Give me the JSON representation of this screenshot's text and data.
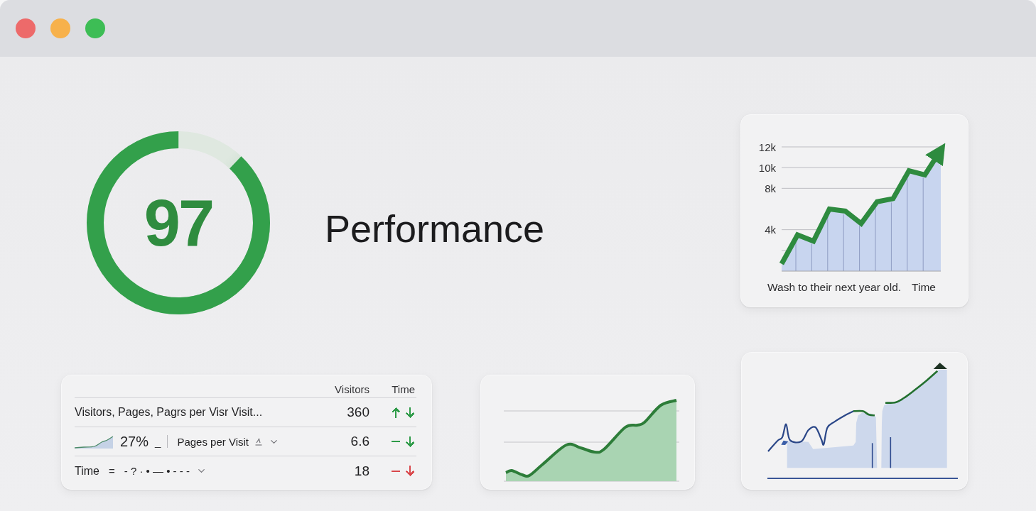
{
  "window": {
    "controls": [
      {
        "color": "#ed6a6a"
      },
      {
        "color": "#f7b14b"
      },
      {
        "color": "#3dbd55"
      }
    ]
  },
  "score": {
    "value": "97",
    "level": 0.88,
    "title": "Performance"
  },
  "trend_card": {
    "chart_data": {
      "type": "area",
      "xlabel": "Time",
      "categories": [
        null,
        null,
        null,
        null,
        null,
        null,
        null,
        null,
        null,
        null,
        null
      ],
      "series": [
        {
          "color": "#2e8b3f",
          "values": [
            700,
            3500,
            2900,
            6000,
            5800,
            4600,
            6700,
            7000,
            9700,
            9300,
            11700
          ]
        }
      ],
      "ylim": [
        0,
        12000
      ],
      "yticks": [
        {
          "value": 4000,
          "label": "4k"
        },
        {
          "value": 8000,
          "label": "8k"
        },
        {
          "value": 10000,
          "label": "10k"
        },
        {
          "value": 12000,
          "label": "12k"
        }
      ],
      "grid": true
    },
    "caption": "Wash to their next year old."
  },
  "table": {
    "columns": [
      "Visitors",
      "Time"
    ],
    "rows": [
      {
        "kind": "text",
        "label": "Visitors, Pages, Pagrs per Visr Visit...",
        "value": "360",
        "indicators": [
          {
            "kind": "up",
            "color": "#2e9b48"
          },
          {
            "kind": "down",
            "color": "#2e9b48"
          }
        ]
      },
      {
        "kind": "metric",
        "percent": "27%",
        "mark": "_",
        "select": "Pages per Visit",
        "value": "6.6",
        "indicators": [
          {
            "kind": "flat",
            "color": "#2e9b48"
          },
          {
            "kind": "down",
            "color": "#2e9b48"
          }
        ]
      },
      {
        "kind": "filter",
        "label": "Time",
        "operator": "=",
        "filter": "- ? · • — • - - -",
        "value": "18",
        "indicators": [
          {
            "kind": "flat",
            "color": "#d9474b"
          },
          {
            "kind": "down",
            "color": "#d9474b"
          }
        ]
      }
    ]
  }
}
